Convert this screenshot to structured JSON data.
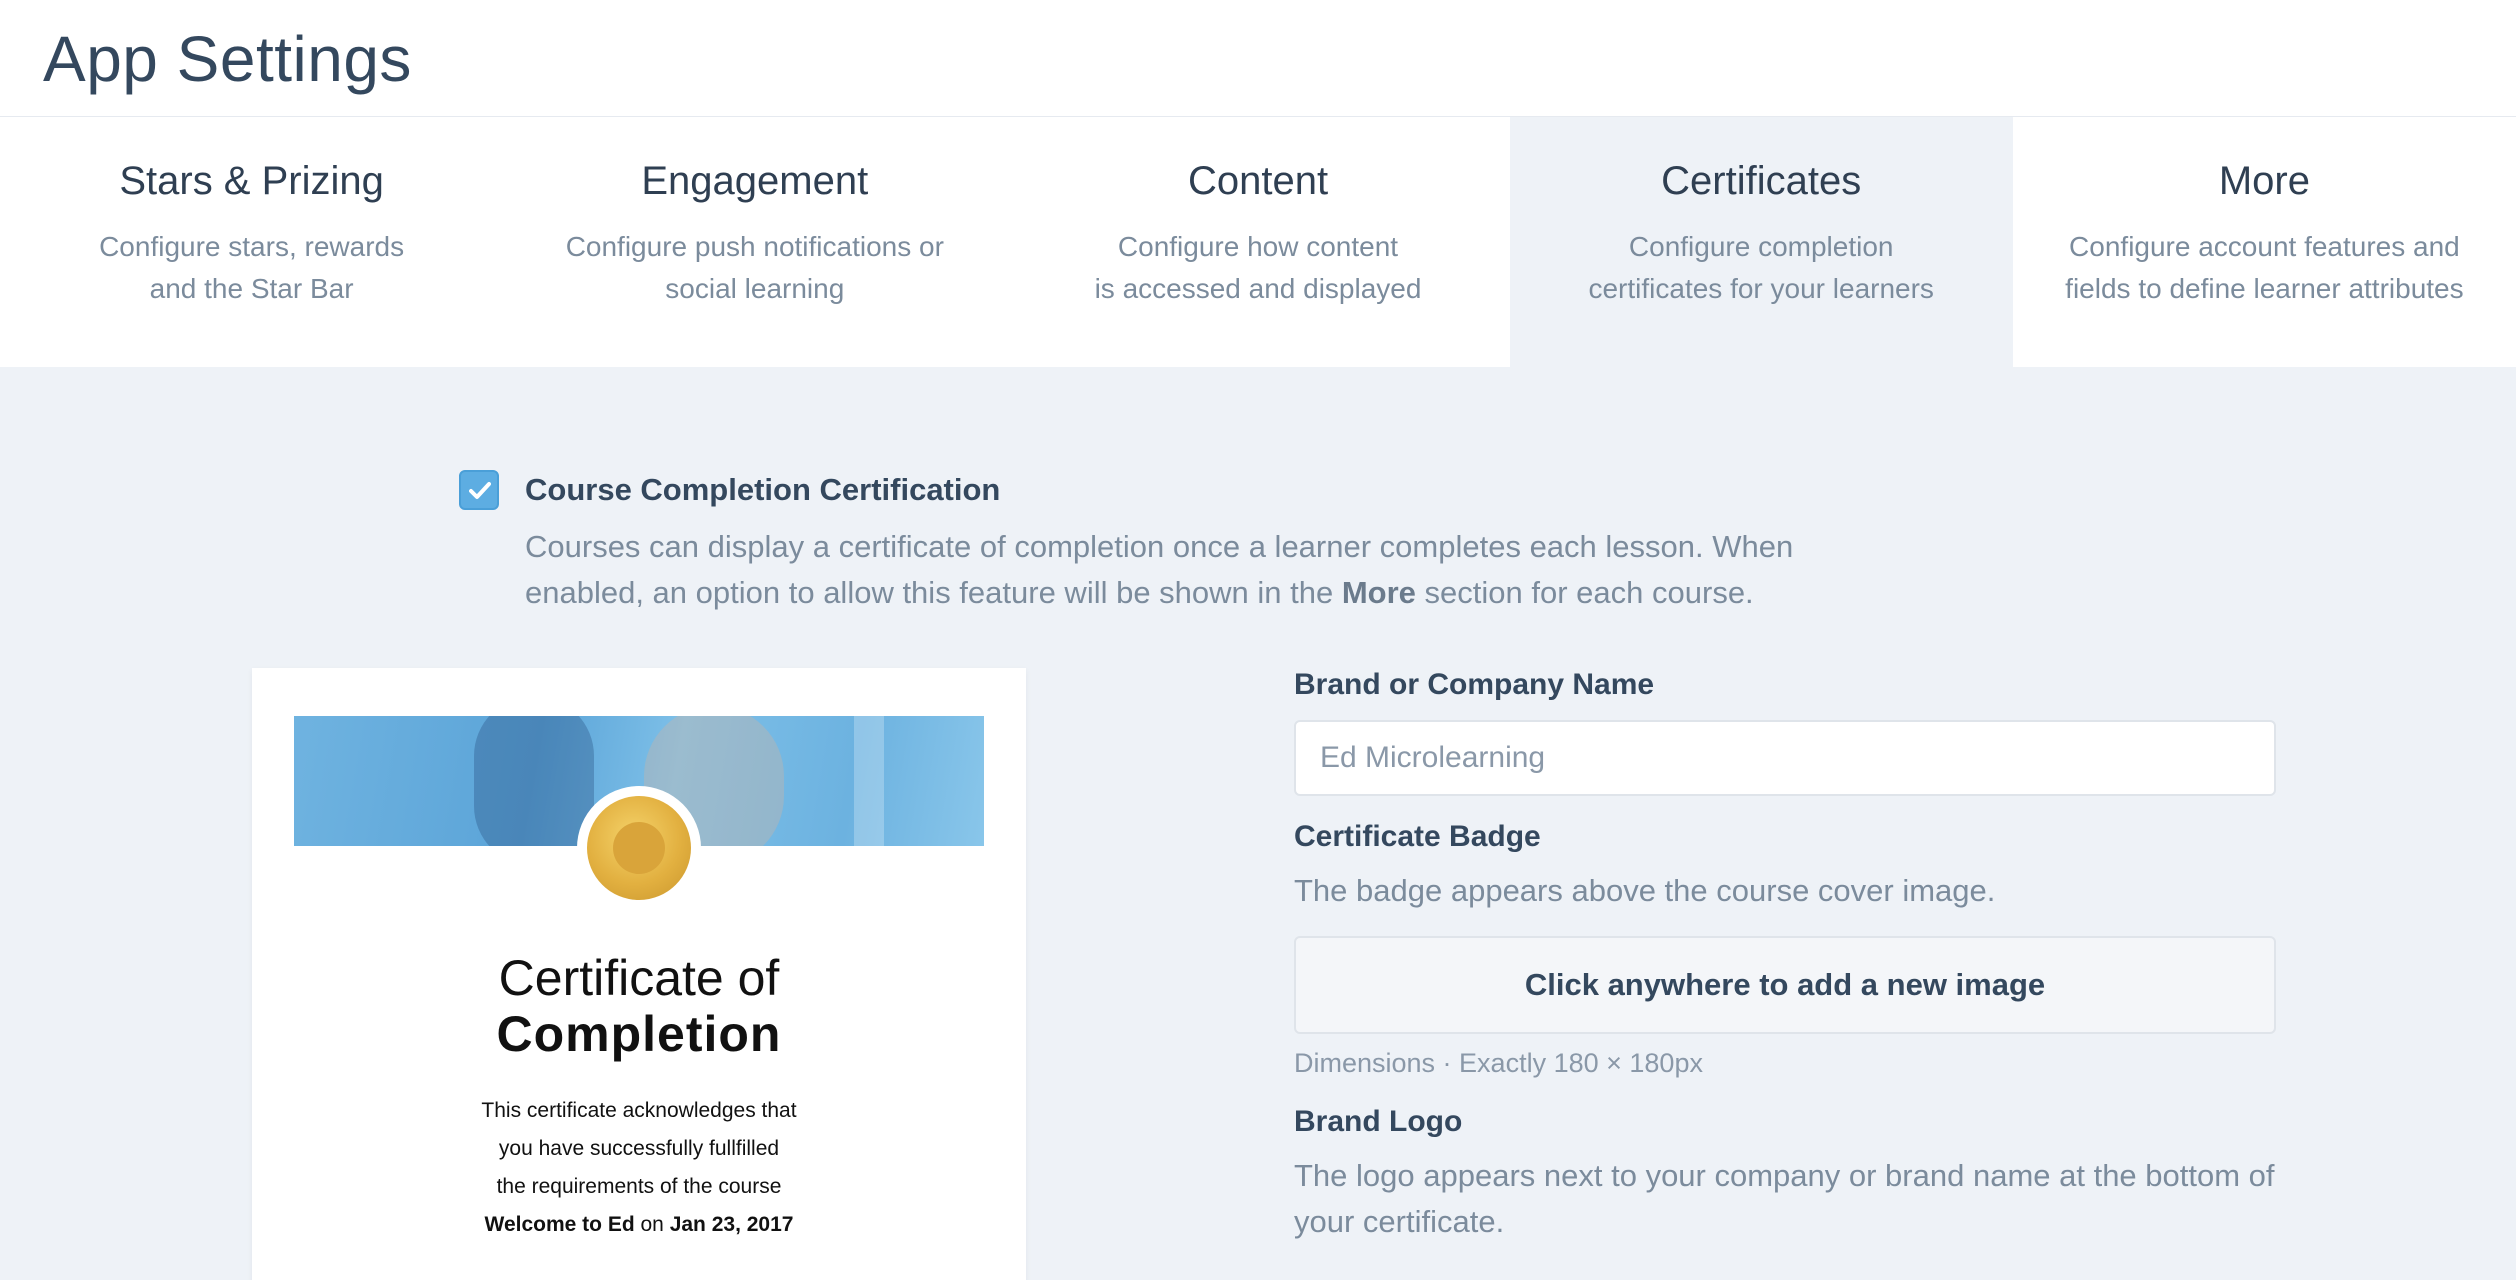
{
  "page": {
    "title": "App Settings"
  },
  "tabs": [
    {
      "title": "Stars & Prizing",
      "desc": "Configure stars, rewards\nand the Star Bar",
      "active": false
    },
    {
      "title": "Engagement",
      "desc": "Configure push notifications or\nsocial learning",
      "active": false
    },
    {
      "title": "Content",
      "desc": "Configure how content\nis accessed and displayed",
      "active": false
    },
    {
      "title": "Certificates",
      "desc": "Configure completion\ncertificates for your learners",
      "active": true
    },
    {
      "title": "More",
      "desc": "Configure account features and\nfields to define learner attributes",
      "active": false
    }
  ],
  "certification": {
    "checked": true,
    "title": "Course Completion Certification",
    "desc_pre": "Courses can display a certificate of completion once a learner completes each lesson. When enabled, an option to allow this feature will be shown in the ",
    "desc_bold": "More",
    "desc_post": " section for each course."
  },
  "preview": {
    "title_line1": "Certificate of",
    "title_line2": "Completion",
    "body_line1": "This certificate acknowledges that",
    "body_line2": "you have successfully fullfilled",
    "body_line3": "the requirements of the course",
    "course_name": "Welcome to Ed",
    "on_word": "on",
    "date": "Jan 23, 2017"
  },
  "form": {
    "brand_label": "Brand or Company Name",
    "brand_placeholder": "Ed Microlearning",
    "badge_label": "Certificate Badge",
    "badge_help": "The badge appears above the course cover image.",
    "upload_label": "Click anywhere to add a new image",
    "dimensions": "Dimensions · Exactly 180 × 180px",
    "logo_label": "Brand Logo",
    "logo_help": "The logo appears next to your company or brand name at the bottom of your certificate."
  },
  "colors": {
    "accent": "#5dade2",
    "heading": "#34485e",
    "muted": "#7b8b9c",
    "background": "#eef2f7"
  }
}
